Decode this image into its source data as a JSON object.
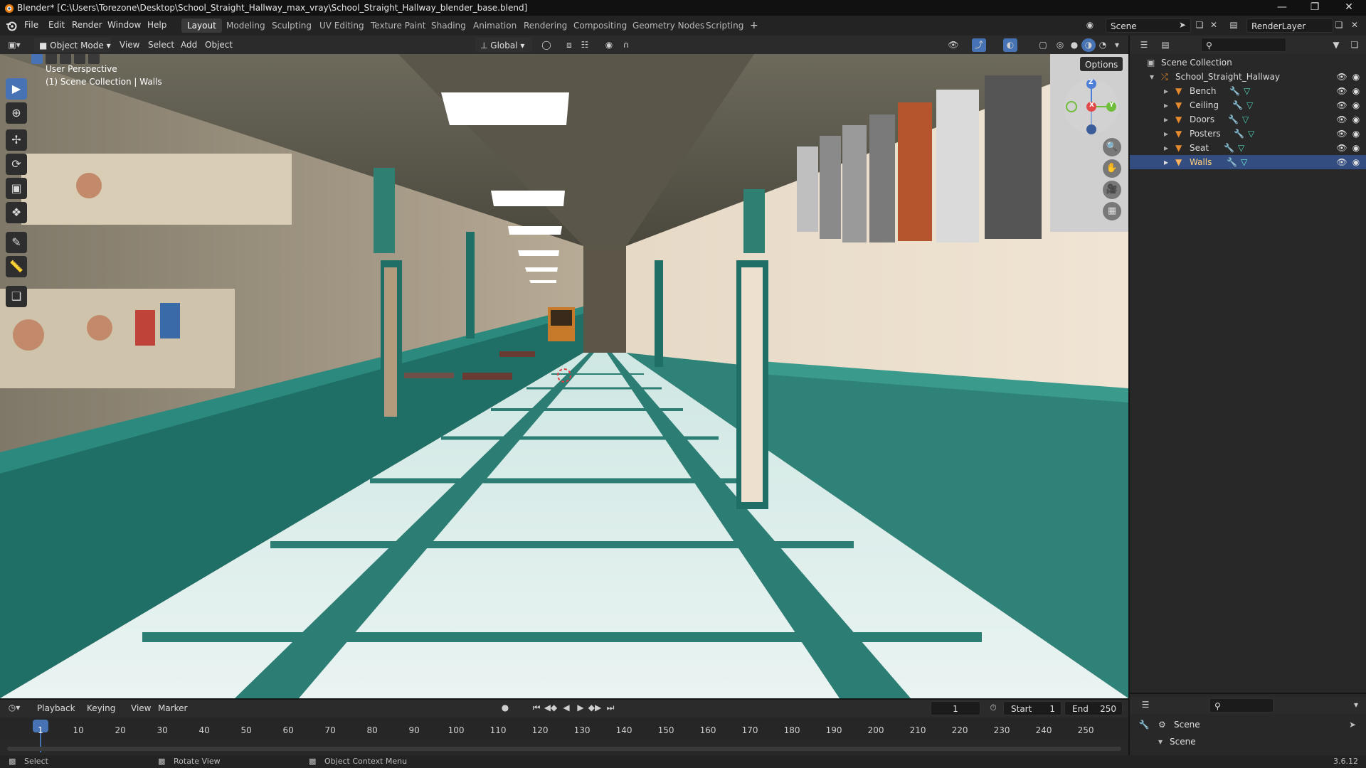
{
  "window": {
    "title": "Blender* [C:\\Users\\Torezone\\Desktop\\School_Straight_Hallway_max_vray\\School_Straight_Hallway_blender_base.blend]",
    "minimize_icon": "minimize-icon",
    "maximize_icon": "restore-icon",
    "close_icon": "close-icon"
  },
  "menubar": {
    "menus": [
      "File",
      "Edit",
      "Render",
      "Window",
      "Help"
    ],
    "workspaces": [
      "Layout",
      "Modeling",
      "Sculpting",
      "UV Editing",
      "Texture Paint",
      "Shading",
      "Animation",
      "Rendering",
      "Compositing",
      "Geometry Nodes",
      "Scripting"
    ],
    "active_workspace": "Layout",
    "add_workspace": "+",
    "scene": "Scene",
    "view_layer": "RenderLayer"
  },
  "viewport_header": {
    "mode": "Object Mode",
    "menus": [
      "View",
      "Select",
      "Add",
      "Object"
    ],
    "orientation": "Global",
    "options": "Options"
  },
  "viewport": {
    "perspective": "User Perspective",
    "collection": "(1) Scene Collection | Walls",
    "axis": {
      "x": "X",
      "y": "Y",
      "z": "Z"
    },
    "tools": [
      "select-box-icon",
      "cursor-icon",
      "move-icon",
      "rotate-icon",
      "scale-icon",
      "transform-icon",
      "annotate-icon",
      "measure-icon",
      "add-cube-icon"
    ],
    "nav": [
      "zoom-icon",
      "hand-pan-icon",
      "camera-icon",
      "grid-view-icon"
    ]
  },
  "outliner": {
    "root": "Scene Collection",
    "collection": "School_Straight_Hallway",
    "objects": [
      "Bench",
      "Ceiling",
      "Doors",
      "Posters",
      "Seat",
      "Walls"
    ],
    "selected": "Walls"
  },
  "properties": {
    "scene_label": "Scene",
    "scene_panel": "Scene"
  },
  "timeline": {
    "menus": [
      "Playback",
      "Keying",
      "View",
      "Marker"
    ],
    "current_frame": "1",
    "start_label": "Start",
    "start": "1",
    "end_label": "End",
    "end": "250",
    "ticks": [
      "1",
      "10",
      "20",
      "30",
      "40",
      "50",
      "60",
      "70",
      "80",
      "90",
      "100",
      "110",
      "120",
      "130",
      "140",
      "150",
      "160",
      "170",
      "180",
      "190",
      "200",
      "210",
      "220",
      "230",
      "240",
      "250"
    ]
  },
  "statusbar": {
    "select": "Select",
    "rotate": "Rotate View",
    "context": "Object Context Menu",
    "version": "3.6.12"
  },
  "colors": {
    "accent": "#4772b3",
    "selected_row": "#334d80",
    "teal_wall": "#2f8278",
    "wall_cream": "#e9dccb"
  }
}
